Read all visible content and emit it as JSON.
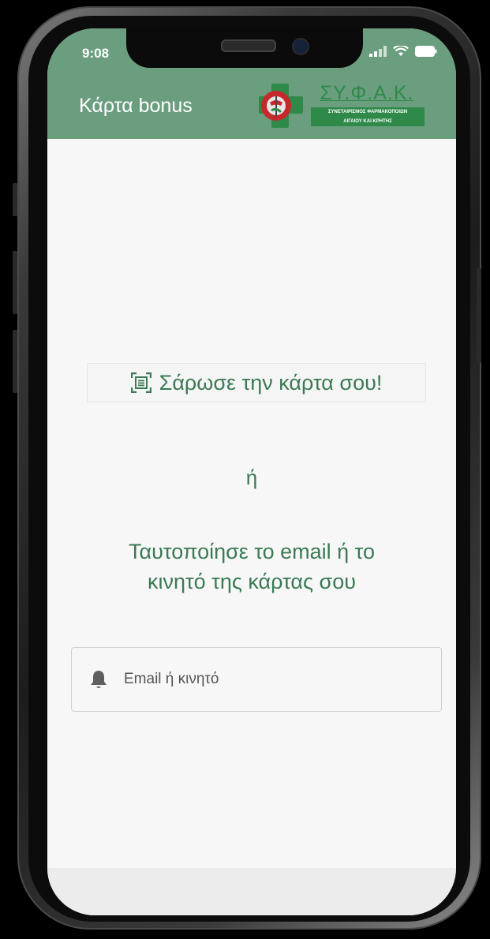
{
  "status_bar": {
    "time": "9:08"
  },
  "header": {
    "title": "Κάρτα bonus",
    "logo": {
      "name": "ΣΥ.Φ.Α.Κ.",
      "subtitle_line1": "ΣΥΝΕΤΑΙΡΙΣΜΟΣ ΦΑΡΜΑΚΟΠΟΙΩΝ",
      "subtitle_line2": "ΑΙΓΑΙΟΥ ΚΑΙ ΚΡΗΤΗΣ"
    }
  },
  "main": {
    "scan_button_label": "Σάρωσε την κάρτα σου!",
    "scan_icon": "qr-scan-icon",
    "or_text": "ή",
    "verify_line1": "Ταυτοποίησε το email ή το",
    "verify_line2": "κινητό της κάρτας σου",
    "input": {
      "placeholder": "Email ή κινητό",
      "value": "",
      "icon": "bell-icon"
    }
  },
  "colors": {
    "header": "#6a9e7e",
    "accent_text": "#3b7a54",
    "logo_green": "#2f8a4a",
    "screen_bg": "#f7f7f7"
  }
}
